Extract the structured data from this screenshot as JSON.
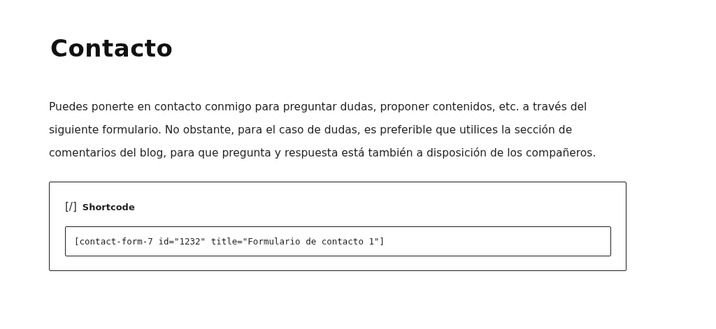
{
  "page": {
    "title": "Contacto",
    "intro": "Puedes ponerte en contacto conmigo para preguntar dudas, proponer contenidos, etc. a través del siguiente formulario. No obstante, para el caso de dudas, es preferible que utilices la sección de comentarios del blog, para que pregunta y respuesta está también a disposición de los compañeros."
  },
  "shortcode_block": {
    "icon": "[/]",
    "label": "Shortcode",
    "value": "[contact-form-7 id=\"1232\" title=\"Formulario de contacto 1\"]"
  }
}
